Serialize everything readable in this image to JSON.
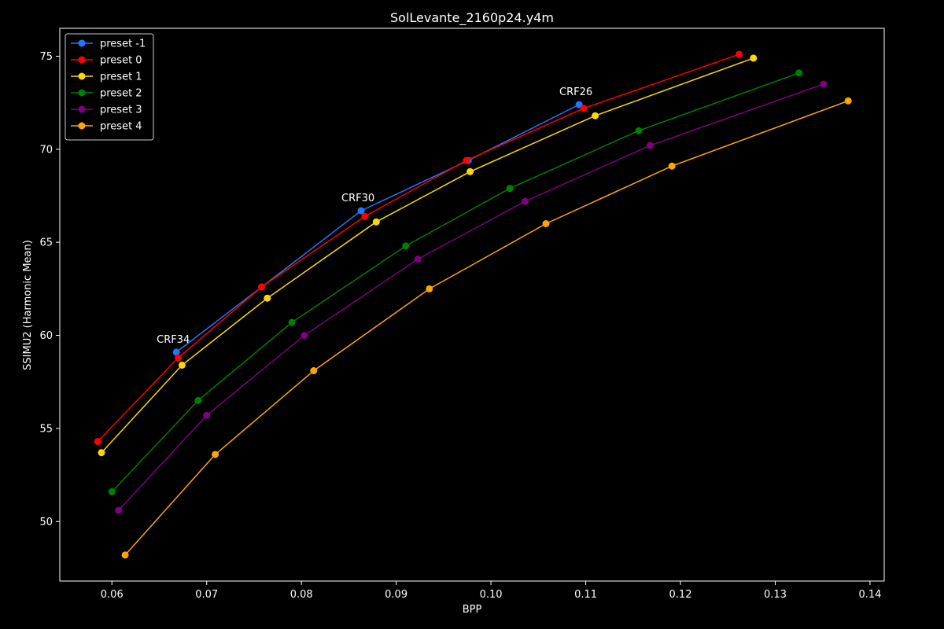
{
  "chart_data": {
    "type": "line",
    "title": "SolLevante_2160p24.y4m",
    "xlabel": "BPP",
    "ylabel": "SSIMU2 (Harmonic Mean)",
    "xlim": [
      0.0545,
      0.1415
    ],
    "ylim": [
      46.8,
      76.5
    ],
    "xticks": [
      0.06,
      0.07,
      0.08,
      0.09,
      0.1,
      0.11,
      0.12,
      0.13,
      0.14
    ],
    "xtick_labels": [
      "0.06",
      "0.07",
      "0.08",
      "0.09",
      "0.10",
      "0.11",
      "0.12",
      "0.13",
      "0.14"
    ],
    "yticks": [
      50,
      55,
      60,
      65,
      70,
      75
    ],
    "ytick_labels": [
      "50",
      "55",
      "60",
      "65",
      "70",
      "75"
    ],
    "grid": false,
    "legend_position": "top-left",
    "background": "#000000",
    "foreground": "#ffffff",
    "series": [
      {
        "name": "preset -1",
        "color": "#1f77ff",
        "points": [
          [
            0.0668,
            59.1
          ],
          [
            0.0758,
            62.6
          ],
          [
            0.0863,
            66.7
          ],
          [
            0.0976,
            69.4
          ],
          [
            0.1093,
            72.4
          ]
        ]
      },
      {
        "name": "preset 0",
        "color": "#ff0000",
        "points": [
          [
            0.0585,
            54.3
          ],
          [
            0.067,
            58.8
          ],
          [
            0.0758,
            62.6
          ],
          [
            0.0867,
            66.4
          ],
          [
            0.0974,
            69.4
          ],
          [
            0.1098,
            72.2
          ],
          [
            0.1262,
            75.1
          ]
        ]
      },
      {
        "name": "preset 1",
        "color": "#ffd700",
        "points": [
          [
            0.0589,
            53.7
          ],
          [
            0.0674,
            58.4
          ],
          [
            0.0764,
            62.0
          ],
          [
            0.0879,
            66.1
          ],
          [
            0.0978,
            68.8
          ],
          [
            0.111,
            71.8
          ],
          [
            0.1277,
            74.9
          ]
        ]
      },
      {
        "name": "preset 2",
        "color": "#008000",
        "points": [
          [
            0.06,
            51.6
          ],
          [
            0.0691,
            56.5
          ],
          [
            0.079,
            60.7
          ],
          [
            0.091,
            64.8
          ],
          [
            0.102,
            67.9
          ],
          [
            0.1156,
            71.0
          ],
          [
            0.1325,
            74.1
          ]
        ]
      },
      {
        "name": "preset 3",
        "color": "#800080",
        "points": [
          [
            0.0607,
            50.6
          ],
          [
            0.07,
            55.7
          ],
          [
            0.0803,
            60.0
          ],
          [
            0.0923,
            64.1
          ],
          [
            0.1036,
            67.2
          ],
          [
            0.1168,
            70.2
          ],
          [
            0.1351,
            73.5
          ]
        ]
      },
      {
        "name": "preset 4",
        "color": "#ffa500",
        "points": [
          [
            0.0614,
            48.2
          ],
          [
            0.0709,
            53.6
          ],
          [
            0.0813,
            58.1
          ],
          [
            0.0935,
            62.5
          ],
          [
            0.1058,
            66.0
          ],
          [
            0.1191,
            69.1
          ],
          [
            0.1377,
            72.6
          ]
        ]
      }
    ],
    "annotations": [
      {
        "text": "CRF34",
        "x": 0.0668,
        "y": 59.1
      },
      {
        "text": "CRF30",
        "x": 0.0863,
        "y": 66.7
      },
      {
        "text": "CRF26",
        "x": 0.1093,
        "y": 72.4
      }
    ]
  }
}
